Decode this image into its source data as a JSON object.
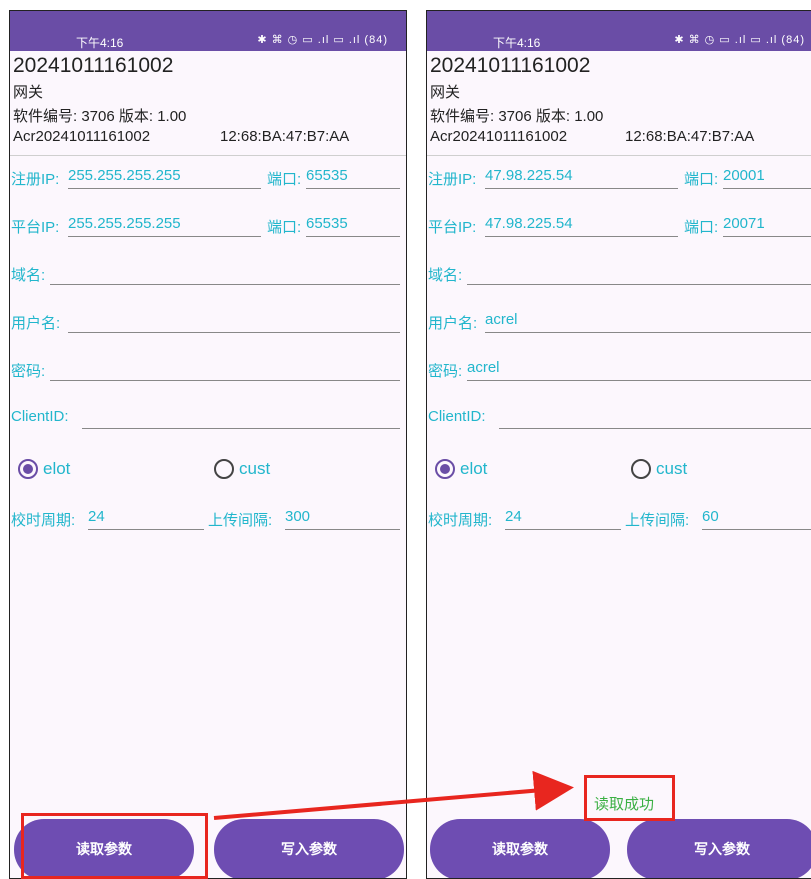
{
  "left": {
    "status_time": "下午4:16",
    "status_icons": "✱ ⌘ ◷ ▭ .ıl ▭ .ıl (84)",
    "device_id": "20241011161002",
    "device_type": "网关",
    "software_line": "软件编号: 3706  版本: 1.00",
    "serial": "Acr20241011161002",
    "mac": "12:68:BA:47:B7:AA",
    "reg_ip_label": "注册IP:",
    "reg_ip_value": "255.255.255.255",
    "reg_port_label": "端口:",
    "reg_port_value": "65535",
    "plat_ip_label": "平台IP:",
    "plat_ip_value": "255.255.255.255",
    "plat_port_label": "端口:",
    "plat_port_value": "65535",
    "domain_label": "域名:",
    "domain_value": "",
    "username_label": "用户名:",
    "username_value": "",
    "password_label": "密码:",
    "password_value": "",
    "clientid_label": "ClientID:",
    "clientid_value": "",
    "radio_elot": "elot",
    "radio_cust": "cust",
    "sync_label": "校时周期:",
    "sync_value": "24",
    "upload_label": "上传间隔:",
    "upload_value": "300",
    "read_button": "读取参数",
    "write_button": "写入参数"
  },
  "right": {
    "status_time": "下午4:16",
    "status_icons": "✱ ⌘ ◷ ▭ .ıl ▭ .ıl (84)",
    "device_id": "20241011161002",
    "device_type": "网关",
    "software_line": "软件编号: 3706  版本: 1.00",
    "serial": "Acr20241011161002",
    "mac": "12:68:BA:47:B7:AA",
    "reg_ip_label": "注册IP:",
    "reg_ip_value": "47.98.225.54",
    "reg_port_label": "端口:",
    "reg_port_value": "20001",
    "plat_ip_label": "平台IP:",
    "plat_ip_value": "47.98.225.54",
    "plat_port_label": "端口:",
    "plat_port_value": "20071",
    "domain_label": "域名:",
    "domain_value": "",
    "username_label": "用户名:",
    "username_value": "acrel",
    "password_label": "密码:",
    "password_value": "acrel",
    "clientid_label": "ClientID:",
    "clientid_value": "",
    "radio_elot": "elot",
    "radio_cust": "cust",
    "sync_label": "校时周期:",
    "sync_value": "24",
    "upload_label": "上传间隔:",
    "upload_value": "60",
    "toast": "读取成功",
    "read_button": "读取参数",
    "write_button": "写入参数"
  },
  "colors": {
    "accent": "#6a4da6",
    "label": "#22b6cc",
    "success": "#3cb044",
    "highlight": "#e8261f"
  }
}
